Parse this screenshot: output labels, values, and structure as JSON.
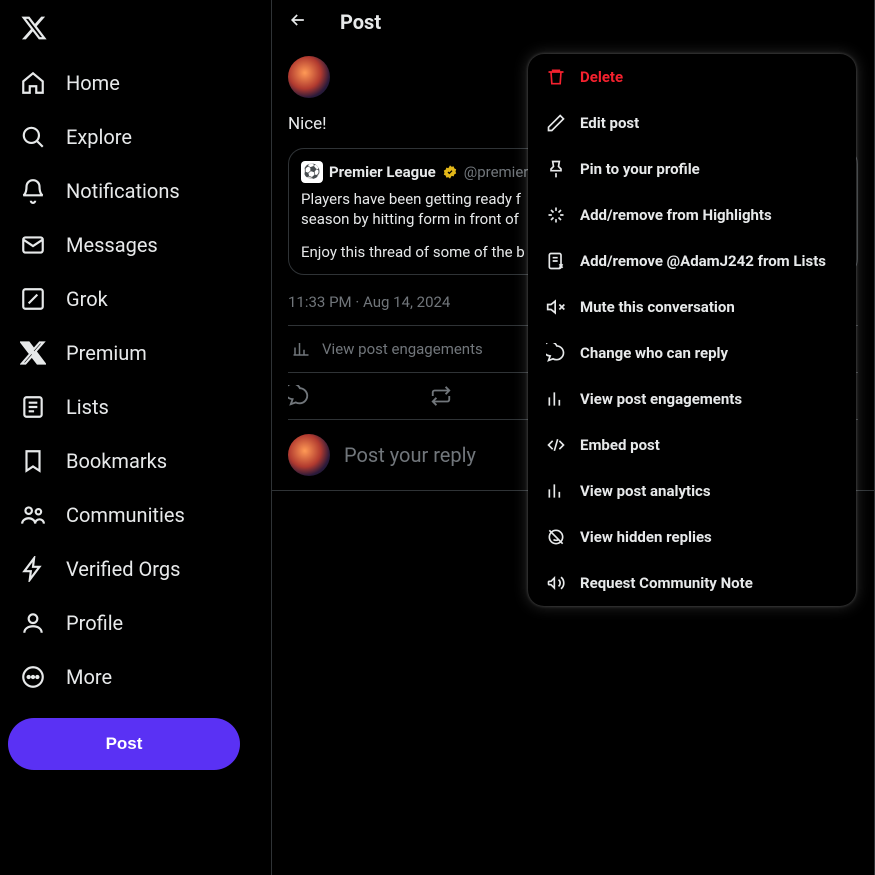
{
  "sidebar": {
    "items": [
      {
        "label": "Home"
      },
      {
        "label": "Explore"
      },
      {
        "label": "Notifications"
      },
      {
        "label": "Messages"
      },
      {
        "label": "Grok"
      },
      {
        "label": "Premium"
      },
      {
        "label": "Lists"
      },
      {
        "label": "Bookmarks"
      },
      {
        "label": "Communities"
      },
      {
        "label": "Verified Orgs"
      },
      {
        "label": "Profile"
      },
      {
        "label": "More"
      }
    ],
    "post_button": "Post"
  },
  "header": {
    "title": "Post"
  },
  "post": {
    "text": "Nice!",
    "timestamp": "11:33 PM · Aug 14, 2024",
    "view_engagements": "View post engagements"
  },
  "quote": {
    "name": "Premier League",
    "handle": "@premier",
    "line1": "Players have been getting ready f",
    "line2": "season by hitting form in front of",
    "line3": "Enjoy this thread of some of the b"
  },
  "reply": {
    "placeholder": "Post your reply"
  },
  "menu": {
    "items": [
      {
        "label": "Delete",
        "danger": true
      },
      {
        "label": "Edit post"
      },
      {
        "label": "Pin to your profile"
      },
      {
        "label": "Add/remove from Highlights"
      },
      {
        "label": "Add/remove @AdamJ242 from Lists"
      },
      {
        "label": "Mute this conversation"
      },
      {
        "label": "Change who can reply"
      },
      {
        "label": "View post engagements"
      },
      {
        "label": "Embed post"
      },
      {
        "label": "View post analytics"
      },
      {
        "label": "View hidden replies"
      },
      {
        "label": "Request Community Note"
      }
    ]
  }
}
